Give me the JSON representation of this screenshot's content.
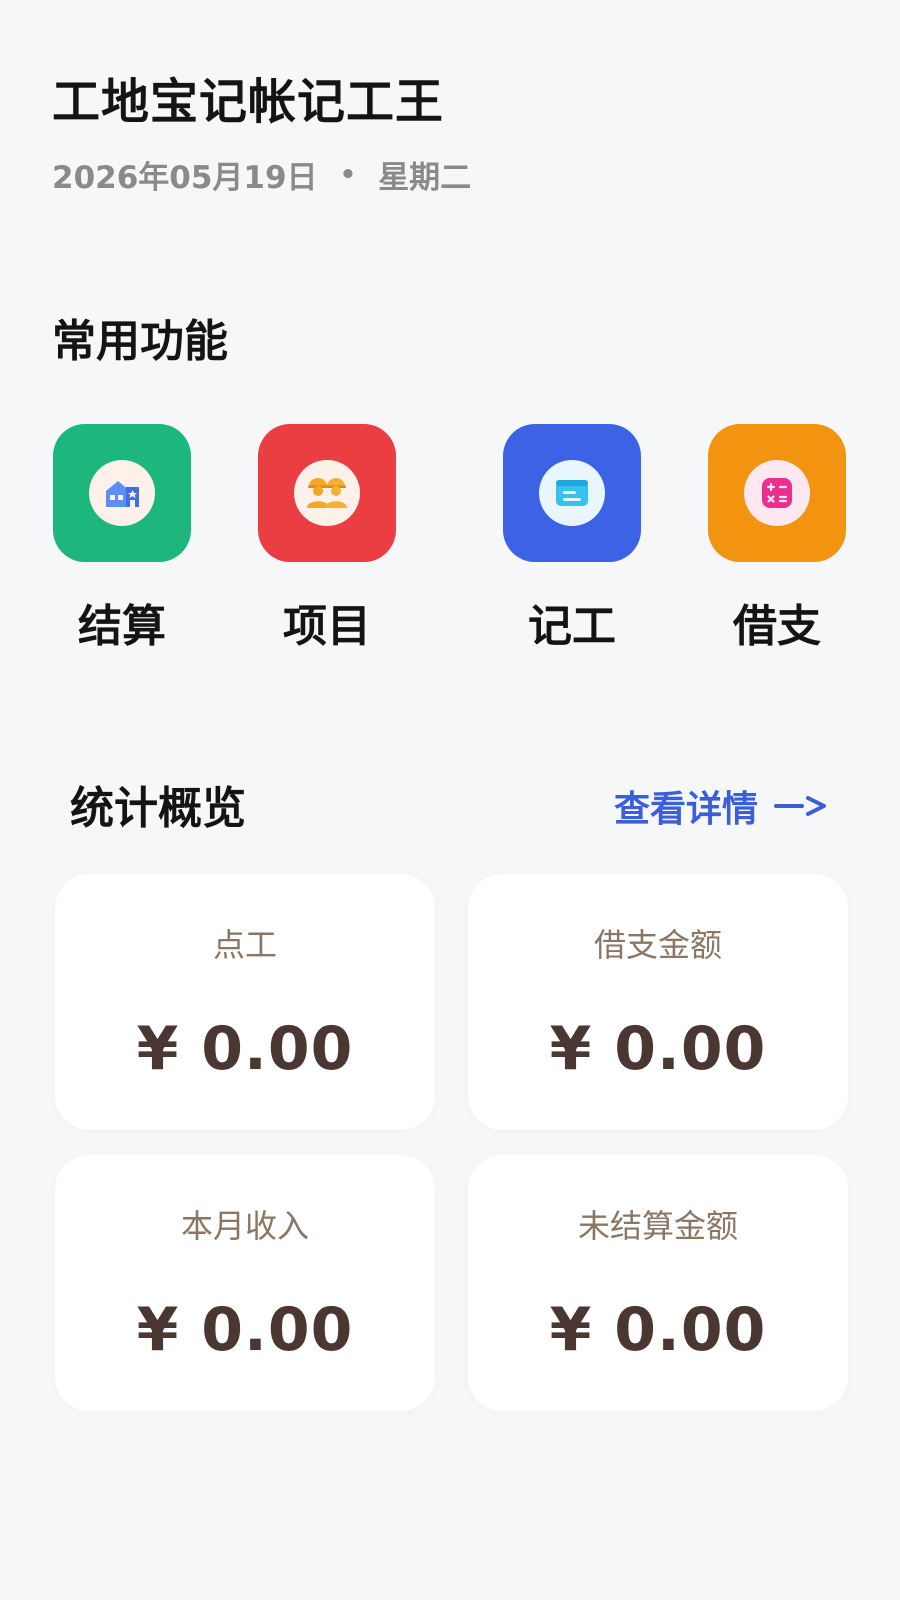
{
  "header": {
    "title": "工地宝记帐记工王",
    "date": "2026年05月19日",
    "separator": "•",
    "weekday": "星期二"
  },
  "common_functions": {
    "title": "常用功能",
    "items": [
      {
        "label": "结算",
        "icon": "house-icon",
        "color": "#1db67c"
      },
      {
        "label": "项目",
        "icon": "workers-icon",
        "color": "#ea3e43"
      },
      {
        "label": "记工",
        "icon": "notepad-icon",
        "color": "#3c63e5"
      },
      {
        "label": "借支",
        "icon": "calculator-icon",
        "color": "#f39411"
      }
    ]
  },
  "stats": {
    "title": "统计概览",
    "details_link": "查看详情",
    "details_arrow": "->",
    "cards": [
      {
        "label": "点工",
        "value": "¥ 0.00"
      },
      {
        "label": "借支金额",
        "value": "¥ 0.00"
      },
      {
        "label": "本月收入",
        "value": "¥ 0.00"
      },
      {
        "label": "未结算金额",
        "value": "¥ 0.00"
      }
    ]
  }
}
